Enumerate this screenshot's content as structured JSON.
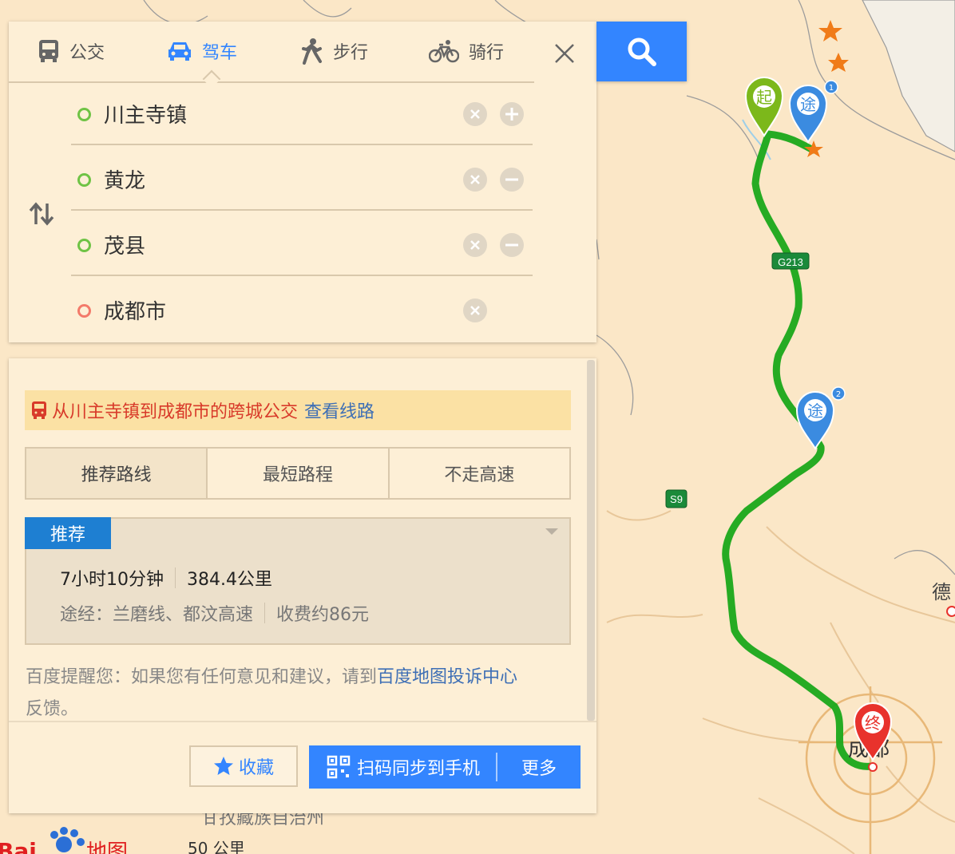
{
  "modes": [
    {
      "label": "公交",
      "icon": "bus-icon",
      "active": false
    },
    {
      "label": "驾车",
      "icon": "car-icon",
      "active": true
    },
    {
      "label": "步行",
      "icon": "walk-icon",
      "active": false
    },
    {
      "label": "骑行",
      "icon": "bike-icon",
      "active": false
    }
  ],
  "stops": [
    {
      "name": "川主寺镇",
      "action": "add"
    },
    {
      "name": "黄龙",
      "action": "remove"
    },
    {
      "name": "茂县",
      "action": "remove"
    },
    {
      "name": "成都市",
      "action": "none"
    }
  ],
  "notice": {
    "text": "从川主寺镇到成都市的跨城公交",
    "link": "查看线路"
  },
  "route_tabs": [
    "推荐路线",
    "最短路程",
    "不走高速"
  ],
  "route": {
    "badge": "推荐",
    "duration": "7小时10分钟",
    "distance": "384.4公里",
    "via": "途经：兰磨线、都汶高速",
    "toll": "收费约86元"
  },
  "feedback": {
    "text": "百度提醒您：如果您有任何意见和建议，请到",
    "link": "百度地图投诉中心",
    "tail": "反馈。"
  },
  "actions": {
    "favorite": "收藏",
    "scan": "扫码同步到手机",
    "more": "更多"
  },
  "map": {
    "markers": {
      "start": "起",
      "via": "途",
      "end": "终",
      "via1_num": "1",
      "via2_num": "2"
    },
    "road_shields": [
      "G213",
      "S9"
    ],
    "labels": {
      "city": "成都",
      "partial_de": "德",
      "prefecture": "甘孜藏族自治州",
      "scale": "50 公里",
      "logo": "地图"
    }
  },
  "colors": {
    "accent": "#3385ff",
    "route": "#1aa81a",
    "start_marker": "#7cb81b",
    "via_marker": "#3b8be0",
    "end_marker": "#e8322c"
  }
}
